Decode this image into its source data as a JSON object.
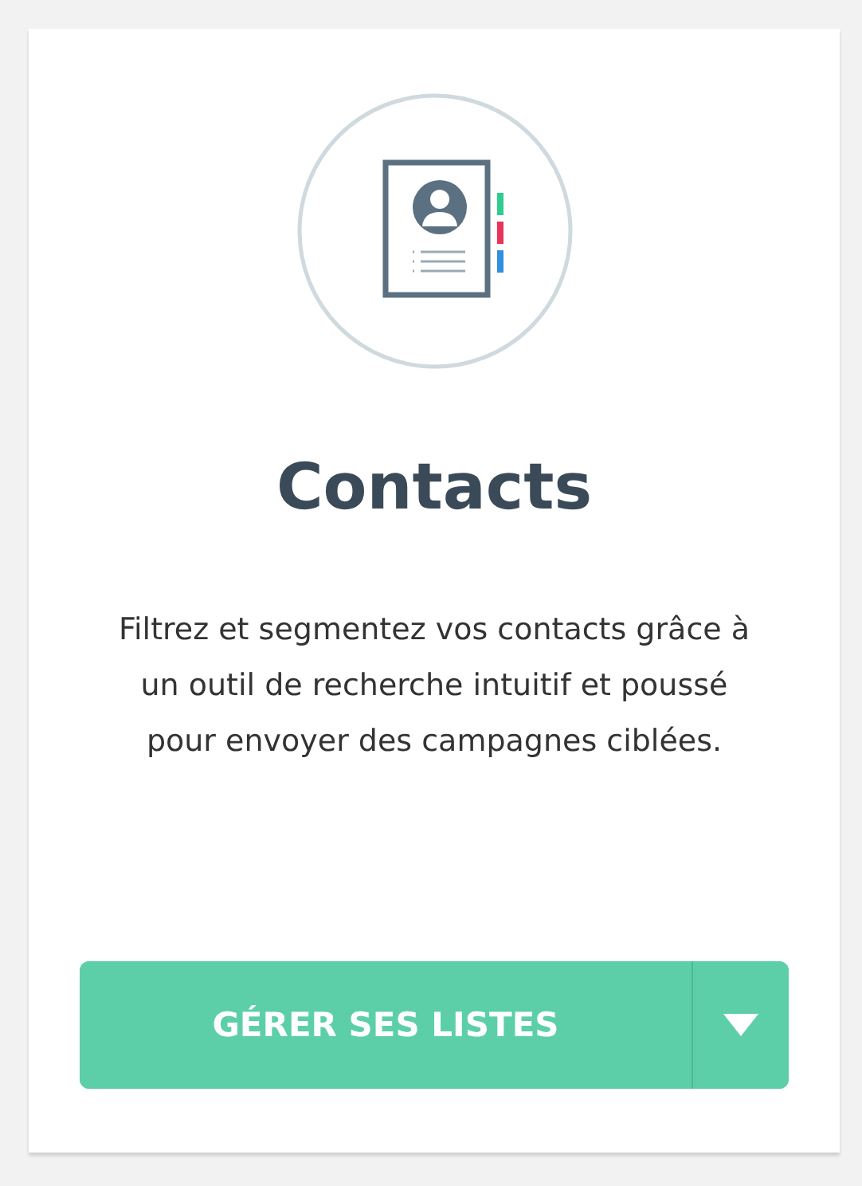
{
  "card": {
    "title": "Contacts",
    "description": "Filtrez et segmentez vos contacts grâce à un outil de recherche intuitif et poussé pour envoyer des campagnes ciblées.",
    "button": {
      "label": "GÉRER SES LISTES",
      "dropdown": true
    }
  }
}
